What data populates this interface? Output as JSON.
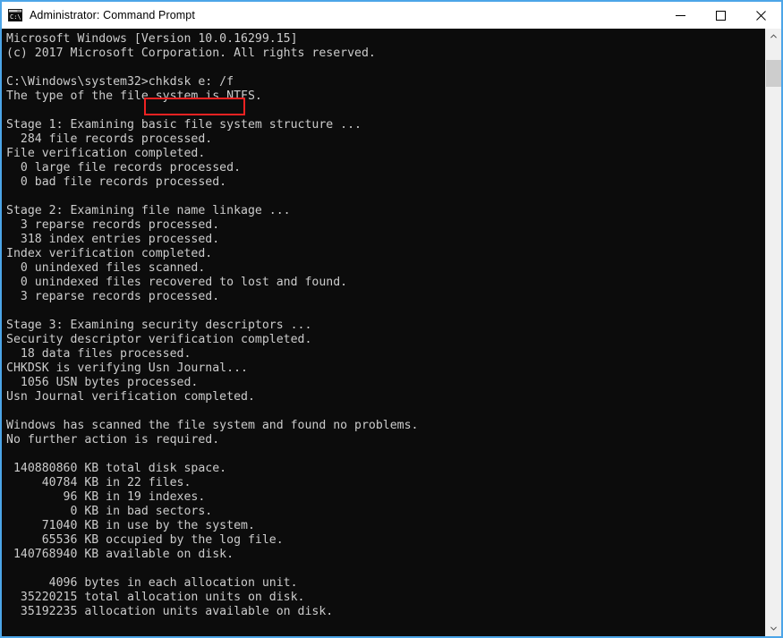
{
  "window": {
    "title": "Administrator: Command Prompt",
    "icon": "command-prompt-icon",
    "border_color": "#4ca5e8",
    "controls": {
      "minimize_label": "—",
      "maximize_label": "☐",
      "close_label": "✕"
    }
  },
  "console": {
    "background": "#0c0c0c",
    "foreground": "#cccccc",
    "highlight_color": "#ee2222",
    "highlighted_command": "chkdsk e: /f",
    "lines": [
      "Microsoft Windows [Version 10.0.16299.15]",
      "(c) 2017 Microsoft Corporation. All rights reserved.",
      "",
      "C:\\Windows\\system32>chkdsk e: /f",
      "The type of the file system is NTFS.",
      "",
      "Stage 1: Examining basic file system structure ...",
      "  284 file records processed.",
      "File verification completed.",
      "  0 large file records processed.",
      "  0 bad file records processed.",
      "",
      "Stage 2: Examining file name linkage ...",
      "  3 reparse records processed.",
      "  318 index entries processed.",
      "Index verification completed.",
      "  0 unindexed files scanned.",
      "  0 unindexed files recovered to lost and found.",
      "  3 reparse records processed.",
      "",
      "Stage 3: Examining security descriptors ...",
      "Security descriptor verification completed.",
      "  18 data files processed.",
      "CHKDSK is verifying Usn Journal...",
      "  1056 USN bytes processed.",
      "Usn Journal verification completed.",
      "",
      "Windows has scanned the file system and found no problems.",
      "No further action is required.",
      "",
      " 140880860 KB total disk space.",
      "     40784 KB in 22 files.",
      "        96 KB in 19 indexes.",
      "         0 KB in bad sectors.",
      "     71040 KB in use by the system.",
      "     65536 KB occupied by the log file.",
      " 140768940 KB available on disk.",
      "",
      "      4096 bytes in each allocation unit.",
      "  35220215 total allocation units on disk.",
      "  35192235 allocation units available on disk."
    ]
  },
  "scrollbar": {
    "up_arrow": "▲",
    "down_arrow": "▼",
    "track_color": "#f0f0f0",
    "thumb_color": "#cdcdcd"
  }
}
